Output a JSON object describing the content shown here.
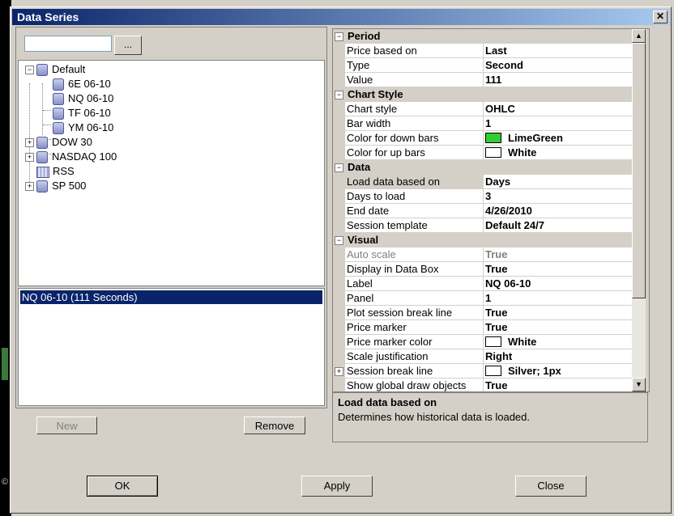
{
  "window": {
    "title": "Data Series",
    "close_glyph": "✕"
  },
  "left": {
    "search_value": "",
    "browse_label": "...",
    "tree": [
      {
        "label": "Default",
        "expander": "−",
        "icon": "database-icon"
      },
      {
        "label": "6E 06-10",
        "icon": "instrument-icon"
      },
      {
        "label": "NQ 06-10",
        "icon": "instrument-icon"
      },
      {
        "label": "TF 06-10",
        "icon": "instrument-icon"
      },
      {
        "label": "YM 06-10",
        "icon": "instrument-icon"
      },
      {
        "label": "DOW 30",
        "expander": "+",
        "icon": "database-icon"
      },
      {
        "label": "NASDAQ 100",
        "expander": "+",
        "icon": "database-icon"
      },
      {
        "label": "RSS",
        "icon": "grid-icon"
      },
      {
        "label": "SP 500",
        "expander": "+",
        "icon": "database-icon"
      }
    ],
    "series_selected": "NQ 06-10 (111 Seconds)",
    "new_label": "New",
    "remove_label": "Remove"
  },
  "grid": {
    "period": {
      "label": "Period",
      "rows": [
        {
          "name": "Price based on",
          "value": "Last"
        },
        {
          "name": "Type",
          "value": "Second"
        },
        {
          "name": "Value",
          "value": "111"
        }
      ]
    },
    "chart_style": {
      "label": "Chart Style",
      "rows": [
        {
          "name": "Chart style",
          "value": "OHLC"
        },
        {
          "name": "Bar width",
          "value": "1"
        },
        {
          "name": "Color for down bars",
          "value": "LimeGreen",
          "color": "#32cd32"
        },
        {
          "name": "Color for up bars",
          "value": "White",
          "color": "#ffffff"
        }
      ]
    },
    "data": {
      "label": "Data",
      "rows": [
        {
          "name": "Load data based on",
          "value": "Days"
        },
        {
          "name": "Days to load",
          "value": "3"
        },
        {
          "name": "End date",
          "value": "4/26/2010"
        },
        {
          "name": "Session template",
          "value": "Default 24/7"
        }
      ]
    },
    "visual": {
      "label": "Visual",
      "rows": [
        {
          "name": "Auto scale",
          "value": "True"
        },
        {
          "name": "Display in Data Box",
          "value": "True"
        },
        {
          "name": "Label",
          "value": "NQ 06-10"
        },
        {
          "name": "Panel",
          "value": "1"
        },
        {
          "name": "Plot session break line",
          "value": "True"
        },
        {
          "name": "Price marker",
          "value": "True"
        },
        {
          "name": "Price marker color",
          "value": "White",
          "color": "#ffffff"
        },
        {
          "name": "Scale justification",
          "value": "Right"
        },
        {
          "name": "Session break line",
          "value": "Silver; 1px",
          "color": "#ffffff"
        },
        {
          "name": "Show global draw objects",
          "value": "True"
        }
      ]
    }
  },
  "help": {
    "title": "Load data based on",
    "description": "Determines how historical data is loaded."
  },
  "buttons": {
    "ok": "OK",
    "apply": "Apply",
    "close": "Close"
  },
  "background_text": "©"
}
